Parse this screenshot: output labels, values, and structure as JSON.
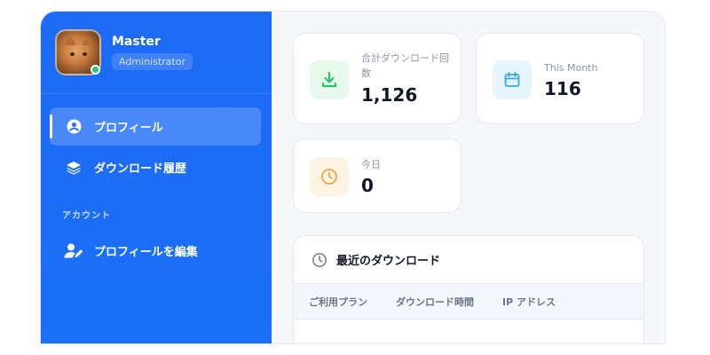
{
  "user": {
    "name": "Master",
    "role": "Administrator"
  },
  "sidebar": {
    "items": [
      {
        "label": "プロフィール",
        "icon": "user-circle-icon",
        "active": true
      },
      {
        "label": "ダウンロード履歴",
        "icon": "layers-icon",
        "active": false
      }
    ],
    "section_label": "アカウント",
    "account_items": [
      {
        "label": "プロフィールを編集",
        "icon": "user-edit-icon"
      }
    ]
  },
  "stats": {
    "total": {
      "label": "合計ダウンロード回数",
      "value": "1,126",
      "icon": "download-icon",
      "color": "#22c55e",
      "bg": "#e7f8ec"
    },
    "month": {
      "label": "This Month",
      "value": "116",
      "icon": "calendar-icon",
      "color": "#38a8e0",
      "bg": "#e6f4fb"
    },
    "today": {
      "label": "今日",
      "value": "0",
      "icon": "clock-icon",
      "color": "#f0a63a",
      "bg": "#fdf3e4"
    }
  },
  "recent": {
    "title": "最近のダウンロード",
    "icon": "clock-icon",
    "columns": [
      "ご利用プラン",
      "ダウンロード時間",
      "IP アドレス"
    ]
  },
  "colors": {
    "sidebar": "#1d6af5",
    "background": "#f5f7fa"
  }
}
